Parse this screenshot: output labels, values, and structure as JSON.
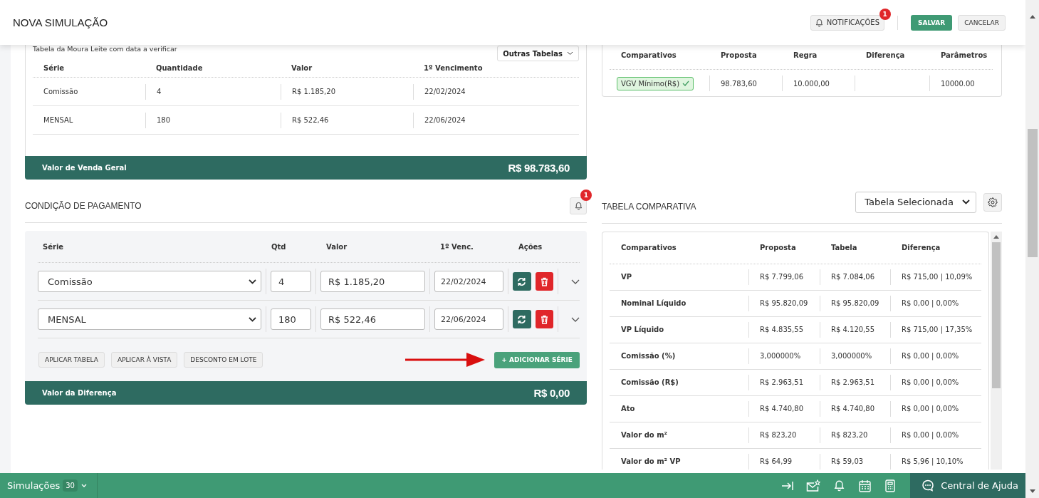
{
  "header": {
    "title": "NOVA SIMULAÇÃO",
    "notifications": {
      "label": "NOTIFICAÇÕES",
      "badge": "1"
    },
    "save": "SALVAR",
    "cancel": "CANCELAR"
  },
  "sales_table": {
    "caption": "Tabela da Moura Leite com data a verificar",
    "other_tables": "Outras Tabelas",
    "columns": [
      "Série",
      "Quantidade",
      "Valor",
      "1º Vencimento"
    ],
    "rows": [
      [
        "Comissão",
        "4",
        "R$ 1.185,20",
        "22/02/2024"
      ],
      [
        "MENSAL",
        "180",
        "R$ 522,46",
        "22/06/2024"
      ]
    ],
    "total": {
      "label": "Valor de Venda Geral",
      "value": "R$ 98.783,60"
    }
  },
  "rules": {
    "columns": [
      "Comparativos",
      "Proposta",
      "Regra",
      "Diferença",
      "Parâmetros"
    ],
    "rows": [
      {
        "tag": "VGV Mínimo(R$)",
        "valid": true,
        "proposta": "98.783,60",
        "regra": "10.000,00",
        "parametros": "10000.00"
      }
    ]
  },
  "payment": {
    "title": "CONDIÇÃO DE PAGAMENTO",
    "alert_badge": "1",
    "columns": [
      "Série",
      "Qtd",
      "Valor",
      "1º Venc.",
      "Ações"
    ],
    "rows": [
      {
        "serie": "Comissão",
        "qtd": "4",
        "valor": "R$ 1.185,20",
        "vencimento": "22/02/2024"
      },
      {
        "serie": "MENSAL",
        "qtd": "180",
        "valor": "R$ 522,46",
        "vencimento": "22/06/2024"
      }
    ],
    "actions": [
      "APLICAR TABELA",
      "APLICAR À VISTA",
      "DESCONTO EM LOTE"
    ],
    "add_button": "+ ADICIONAR SÉRIE",
    "total": {
      "label": "Valor da Diferença",
      "value": "R$ 0,00"
    }
  },
  "comparison": {
    "title": "TABELA COMPARATIVA",
    "select": "Tabela Selecionada",
    "columns": [
      "Comparativos",
      "Proposta",
      "Tabela",
      "Diferença"
    ],
    "rows": [
      {
        "label": "VP",
        "proposta": "R$ 7.799,06",
        "tabela": "R$ 7.084,06",
        "diferenca": "R$ 715,00 | 10,09%"
      },
      {
        "label": "Nominal Líquido",
        "proposta": "R$ 95.820,09",
        "tabela": "R$ 95.820,09",
        "diferenca": "R$ 0,00 | 0,00%"
      },
      {
        "label": "VP Líquido",
        "proposta": "R$ 4.835,55",
        "tabela": "R$ 4.120,55",
        "diferenca": "R$ 715,00 | 17,35%"
      },
      {
        "label": "Comissão (%)",
        "proposta": "3,000000%",
        "tabela": "3,000000%",
        "diferenca": "R$ 0,00 | 0,00%"
      },
      {
        "label": "Comissão (R$)",
        "proposta": "R$ 2.963,51",
        "tabela": "R$ 2.963,51",
        "diferenca": "R$ 0,00 | 0,00%"
      },
      {
        "label": "Ato",
        "proposta": "R$ 4.740,80",
        "tabela": "R$ 4.740,80",
        "diferenca": "R$ 0,00 | 0,00%"
      },
      {
        "label": "Valor do m²",
        "proposta": "R$ 823,20",
        "tabela": "R$ 823,20",
        "diferenca": "R$ 0,00 | 0,00%"
      },
      {
        "label": "Valor do m² VP",
        "proposta": "R$ 64,99",
        "tabela": "R$ 59,03",
        "diferenca": "R$ 5,96 | 10,10%"
      }
    ]
  },
  "bottom_bar": {
    "simulations": "Simulações",
    "count": "30",
    "help": "Central de Ajuda"
  }
}
